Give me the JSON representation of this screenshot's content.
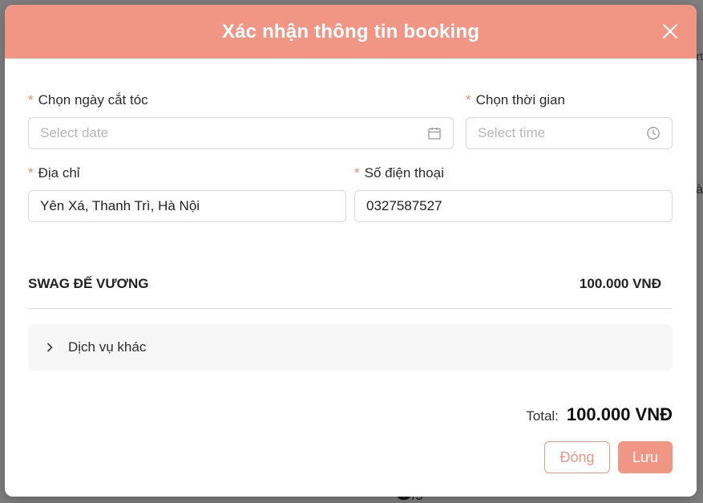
{
  "modal": {
    "title": "Xác nhận thông tin booking",
    "accent_color": "#f19585"
  },
  "form": {
    "date": {
      "label": "Chọn ngày cắt tóc",
      "placeholder": "Select date",
      "required_mark": "*"
    },
    "time": {
      "label": "Chọn thời gian",
      "placeholder": "Select time",
      "required_mark": "*"
    },
    "address": {
      "label": "Địa chỉ",
      "value": "Yên Xá, Thanh Trì, Hà Nội",
      "required_mark": "*"
    },
    "phone": {
      "label": "Số điện thoại",
      "value": "0327587527",
      "required_mark": "*"
    }
  },
  "service": {
    "name": "SWAG ĐẾ VƯƠNG",
    "price": "100.000 VNĐ"
  },
  "other_services": {
    "label": "Dịch vụ khác"
  },
  "total": {
    "label": "Total:",
    "value": "100.000 VNĐ"
  },
  "buttons": {
    "close_label": "Đóng",
    "save_label": "Lưu"
  },
  "background": {
    "partial_text_1": "rt",
    "partial_text_2": "là",
    "page_number": "5",
    "page_total": "/5"
  }
}
